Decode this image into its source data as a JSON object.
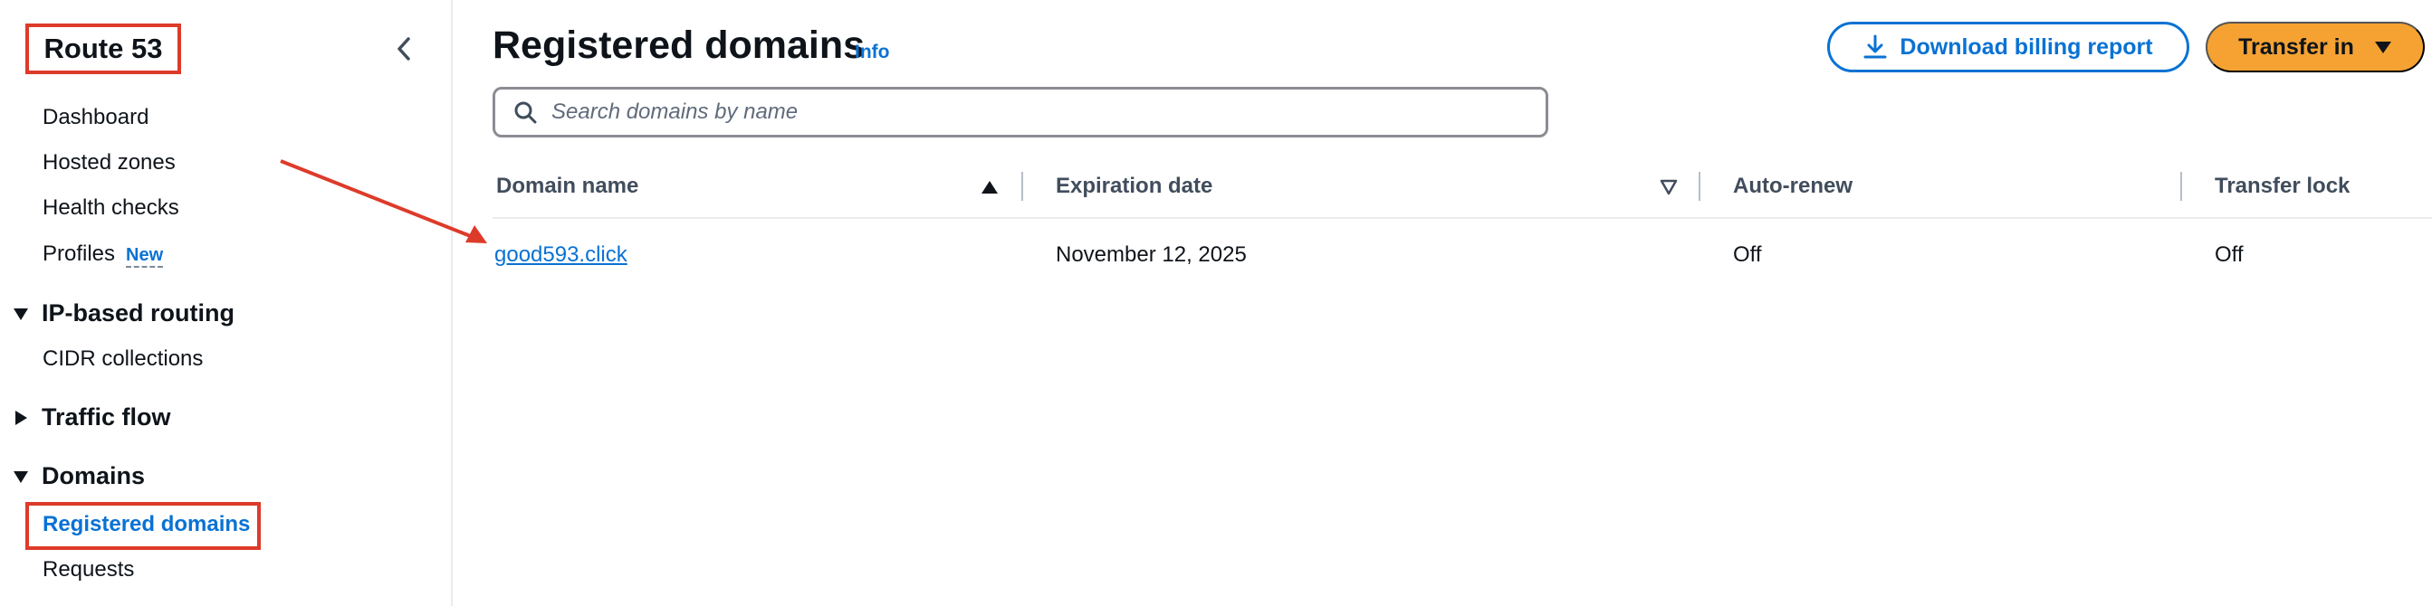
{
  "sidebar": {
    "service_title": "Route 53",
    "items": [
      {
        "label": "Dashboard"
      },
      {
        "label": "Hosted zones"
      },
      {
        "label": "Health checks"
      },
      {
        "label": "Profiles",
        "badge": "New"
      }
    ],
    "sections": [
      {
        "title": "IP-based routing",
        "expanded": true,
        "items": [
          {
            "label": "CIDR collections"
          }
        ]
      },
      {
        "title": "Traffic flow",
        "expanded": false,
        "items": []
      },
      {
        "title": "Domains",
        "expanded": true,
        "items": [
          {
            "label": "Registered domains",
            "active": true
          },
          {
            "label": "Requests"
          }
        ]
      }
    ]
  },
  "header": {
    "title": "Registered domains",
    "info_label": "Info",
    "download_button_label": "Download billing report",
    "transfer_button_label": "Transfer in"
  },
  "search": {
    "placeholder": "Search domains by name",
    "value": ""
  },
  "table": {
    "columns": [
      "Domain name",
      "Expiration date",
      "Auto-renew",
      "Transfer lock"
    ],
    "sort": {
      "column": "Domain name",
      "direction": "ascending"
    },
    "rows": [
      {
        "domain_name": "good593.click",
        "expiration_date": "November 12, 2025",
        "auto_renew": "Off",
        "transfer_lock": "Off"
      }
    ]
  },
  "colors": {
    "accent": "#0972d3",
    "primary_button": "#f5a233",
    "annotation": "#dd3b2a"
  },
  "icons": {
    "collapse": "chevron-left-icon",
    "search": "search-icon",
    "download": "download-icon",
    "dropdown": "caret-down-icon",
    "sort_ascending": "sort-ascending-icon",
    "sortable": "sort-descending-outline-icon"
  }
}
